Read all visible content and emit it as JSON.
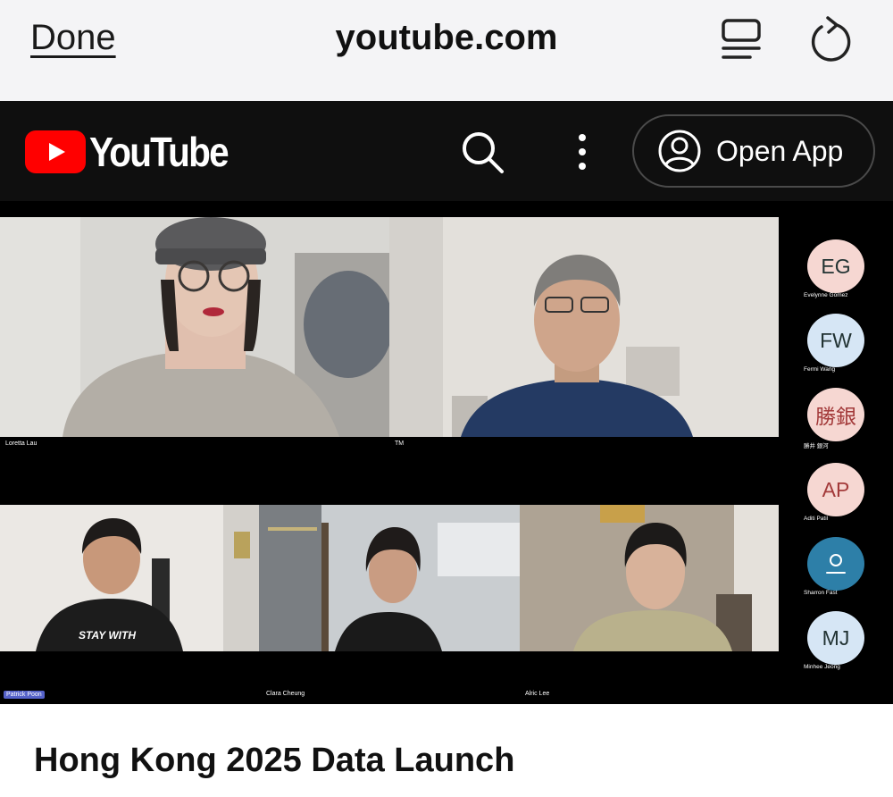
{
  "browser": {
    "done_label": "Done",
    "url": "youtube.com",
    "reader_icon": "reader-view-icon",
    "reload_icon": "reload-icon"
  },
  "youtube": {
    "logo_text": "YouTube",
    "open_app_label": "Open App",
    "brand_red": "#ff0000"
  },
  "meeting": {
    "tiles": [
      {
        "name": "Loretta Lau"
      },
      {
        "name": "TM"
      },
      {
        "name": "Patrick Poon"
      },
      {
        "name": "Clara Cheung"
      },
      {
        "name": "Alric Lee"
      }
    ],
    "participants": [
      {
        "initials": "EG",
        "name": "Evelynne Gomez",
        "color": "#f6d7d2"
      },
      {
        "initials": "FW",
        "name": "Fermi Wang",
        "color": "#d6e6f5"
      },
      {
        "initials": "勝銀",
        "name": "勝井 銀河",
        "color": "#f6d7d2"
      },
      {
        "initials": "AP",
        "name": "Aditi Patil",
        "color": "#f6d7d2"
      },
      {
        "initials": "",
        "name": "Sharron Fast",
        "color": "#2d7fa8"
      },
      {
        "initials": "MJ",
        "name": "Minhee Jeong",
        "color": "#d6e6f5"
      }
    ]
  },
  "video": {
    "title": "Hong Kong 2025 Data Launch"
  }
}
